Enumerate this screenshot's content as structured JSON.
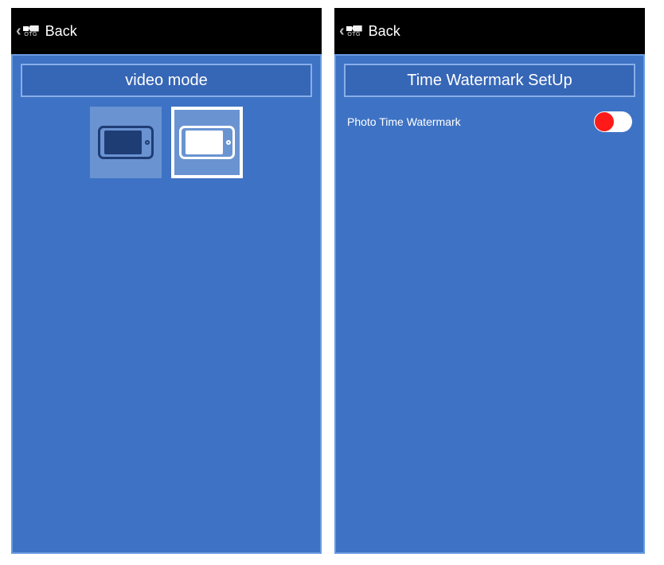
{
  "screens": {
    "left": {
      "back_label": "Back",
      "otg_label": "OTG",
      "title": "video mode"
    },
    "right": {
      "back_label": "Back",
      "otg_label": "OTG",
      "title": "Time Watermark SetUp",
      "setting_label": "Photo Time Watermark",
      "toggle_state": "off"
    }
  }
}
